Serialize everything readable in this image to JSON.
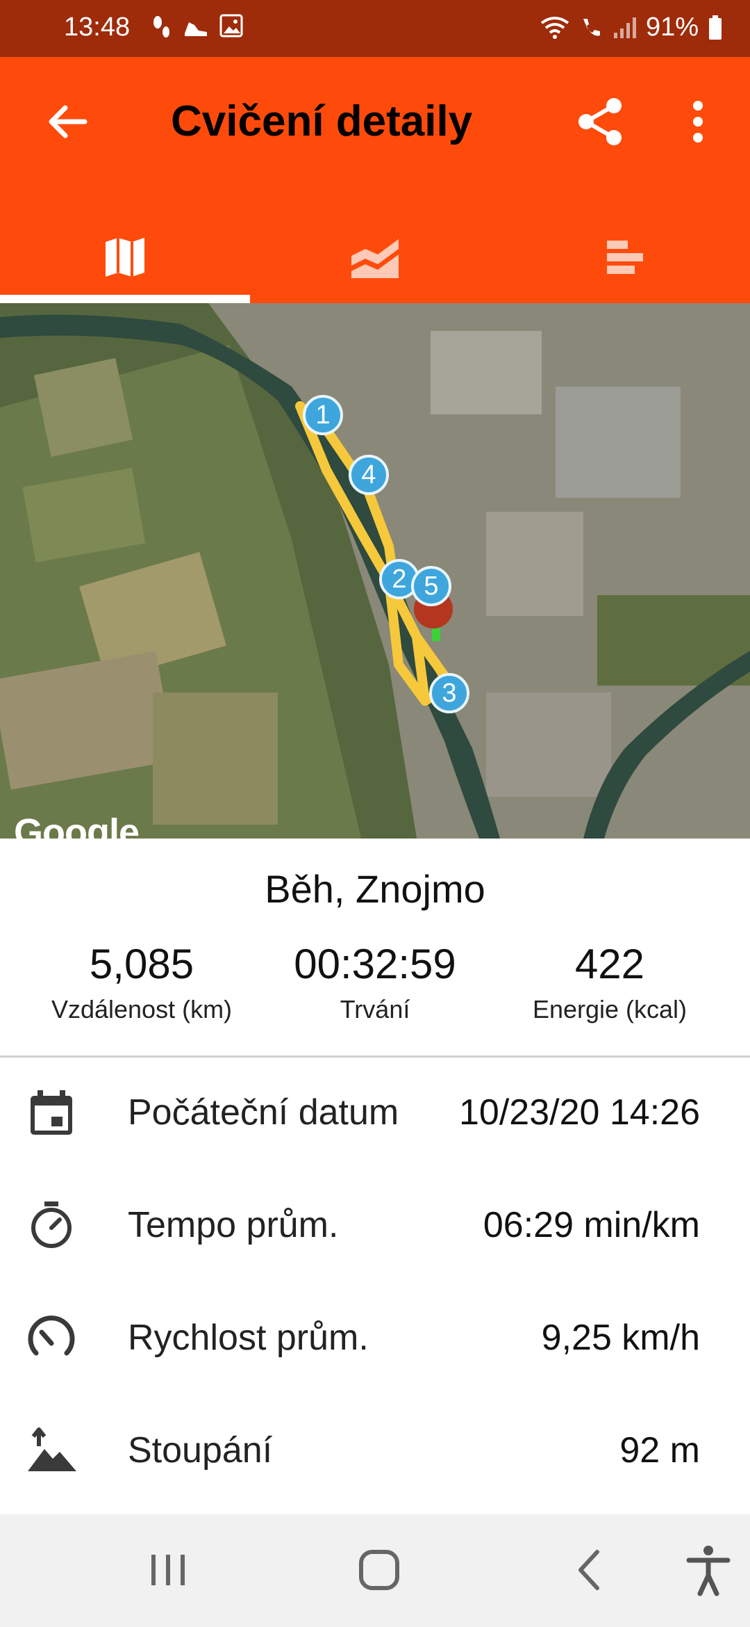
{
  "status_bar": {
    "time": "13:48",
    "battery": "91%",
    "left_icons": [
      "steps-icon",
      "shoe-icon",
      "image-icon"
    ],
    "right_icons": [
      "wifi-icon",
      "wifi-calling-icon",
      "signal-icon",
      "battery-icon"
    ]
  },
  "app_bar": {
    "title": "Cvičení detaily",
    "back_icon": "arrow-back-icon",
    "share_icon": "share-icon",
    "more_icon": "more-vert-icon",
    "colors": {
      "primary": "#fe4b0b",
      "status": "#9e2b0a",
      "route": "#f6c83b",
      "marker": "#3ea6dd"
    }
  },
  "tabs": [
    {
      "name": "map-tab",
      "icon": "map-icon",
      "selected": true
    },
    {
      "name": "chart-tab",
      "icon": "area-chart-icon",
      "selected": false
    },
    {
      "name": "laps-tab",
      "icon": "bars-icon",
      "selected": false
    }
  ],
  "map": {
    "attribution": "Google",
    "markers": [
      "1",
      "2",
      "3",
      "4",
      "5"
    ]
  },
  "summary": {
    "activity": "Běh,",
    "location": "Znojmo",
    "stats": [
      {
        "value": "5,085",
        "label": "Vzdálenost (km)"
      },
      {
        "value": "00:32:59",
        "label": "Trvání"
      },
      {
        "value": "422",
        "label": "Energie (kcal)"
      }
    ]
  },
  "details": [
    {
      "icon": "calendar-icon",
      "label": "Počáteční datum",
      "value": "10/23/20 14:26"
    },
    {
      "icon": "stopwatch-icon",
      "label": "Tempo prům.",
      "value": "06:29 min/km"
    },
    {
      "icon": "speedometer-icon",
      "label": "Rychlost prům.",
      "value": "9,25 km/h"
    },
    {
      "icon": "mountain-icon",
      "label": "Stoupání",
      "value": "92 m"
    }
  ],
  "nav_bar": [
    "recents-icon",
    "home-icon",
    "back-icon",
    "accessibility-icon"
  ]
}
